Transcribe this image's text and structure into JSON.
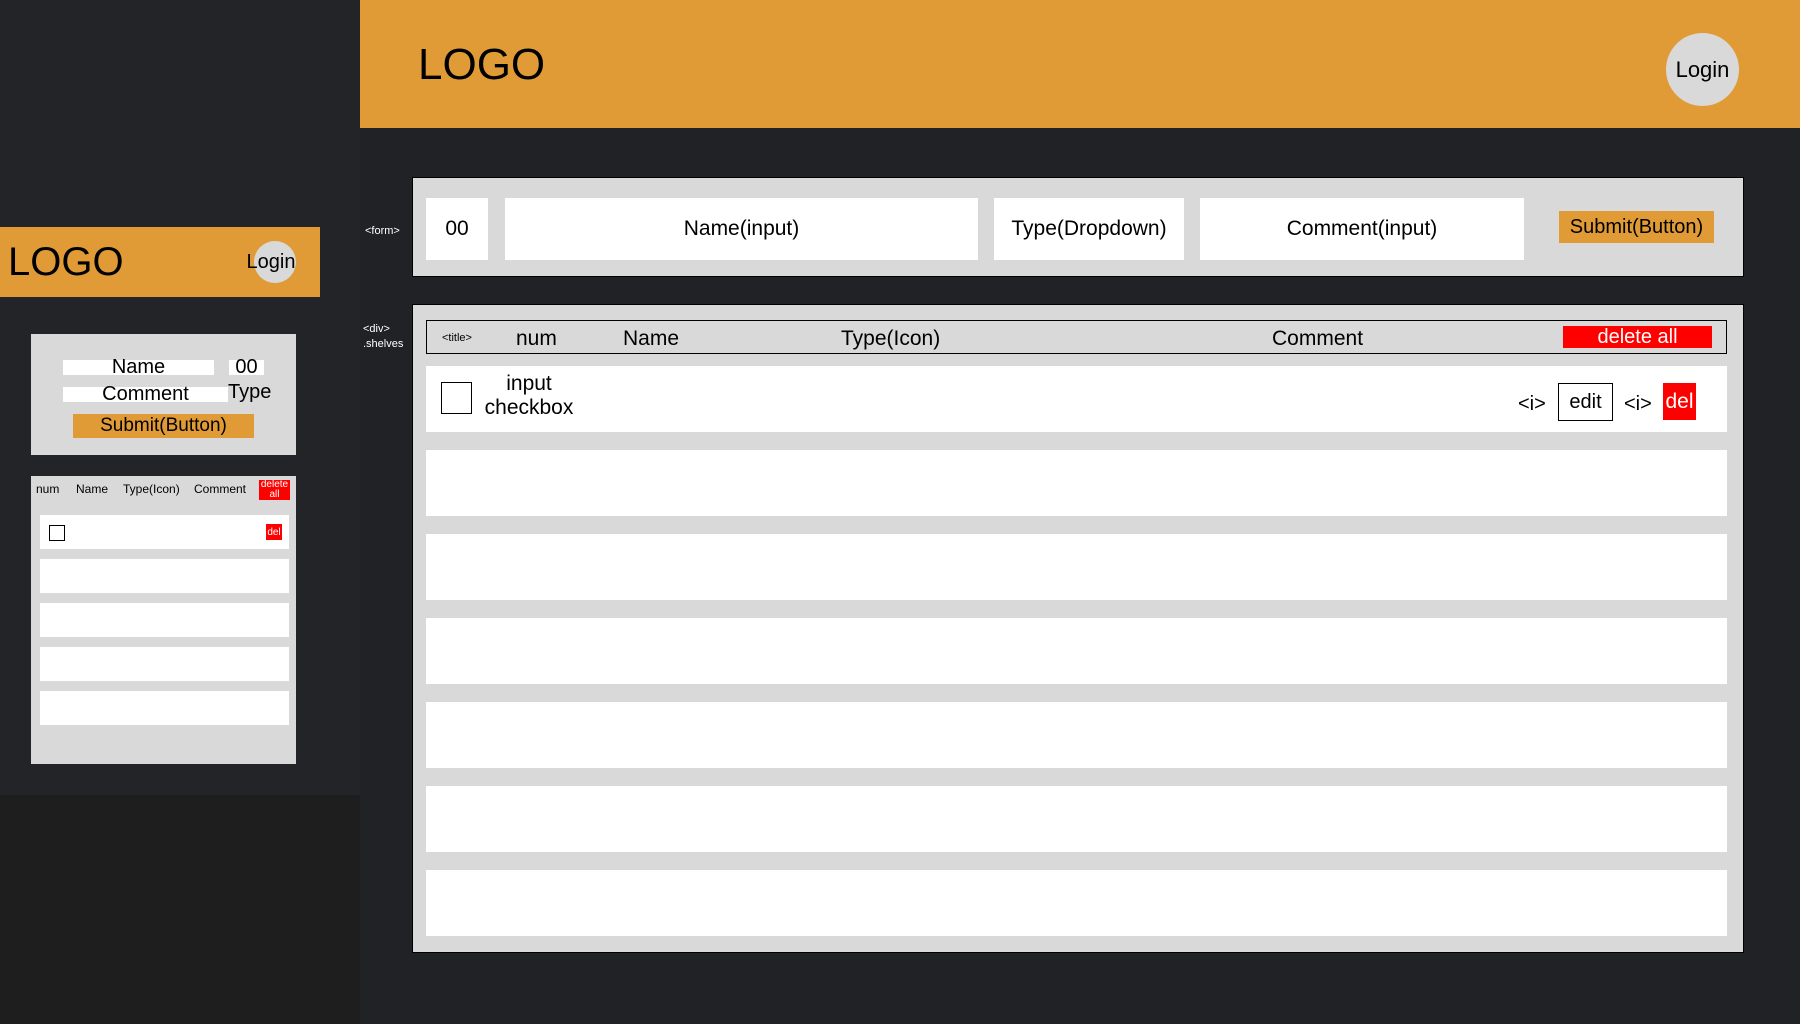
{
  "mobile": {
    "header": {
      "logo": "LOGO",
      "login": "Login"
    },
    "form": {
      "name": "Name",
      "num": "00",
      "comment": "Comment",
      "type": "Type",
      "submit": "Submit(Button)"
    },
    "list": {
      "headers": {
        "num": "num",
        "name": "Name",
        "type": "Type(Icon)",
        "comment": "Comment"
      },
      "delete_all": "delete all",
      "row_delete": "del"
    }
  },
  "desktop": {
    "header": {
      "logo": "LOGO",
      "login": "Login"
    },
    "form": {
      "tag": "<form>",
      "num": "00",
      "name": "Name(input)",
      "type": "Type(Dropdown)",
      "comment": "Comment(input)",
      "submit": "Submit(Button)"
    },
    "shelves": {
      "tag_line1": "<div>",
      "tag_line2": ".shelves",
      "title_tag": "<title>",
      "headers": {
        "num": "num",
        "name": "Name",
        "type": "Type(Icon)",
        "comment": "Comment"
      },
      "delete_all": "delete all",
      "row": {
        "checkbox_line1": "input",
        "checkbox_line2": "checkbox",
        "icon_tag_1": "<i>",
        "edit": "edit",
        "icon_tag_2": "<i>",
        "del": "del"
      }
    }
  },
  "colors": {
    "accent": "#e09b36",
    "danger": "#ff0000",
    "panel": "#d9d9d9",
    "background": "#212226"
  }
}
